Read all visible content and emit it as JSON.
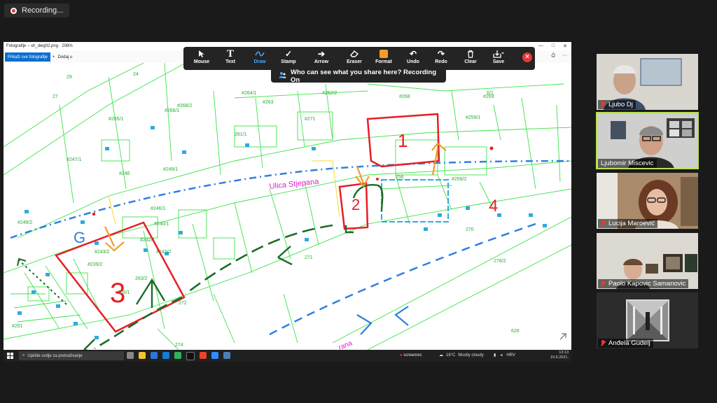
{
  "recording": {
    "label": "Recording..."
  },
  "viewer": {
    "title": "Fotografije – sh_dwg02.png · 208%",
    "tab1": "Prikaži sve fotografije",
    "tab2": "Dodaj u"
  },
  "toolbar": {
    "tools": [
      {
        "label": "Mouse",
        "icon": "mouse-pointer-icon",
        "active": false
      },
      {
        "label": "Text",
        "icon": "text-icon",
        "active": false
      },
      {
        "label": "Draw",
        "icon": "draw-icon",
        "active": true
      },
      {
        "label": "Stamp",
        "icon": "stamp-icon",
        "active": false
      },
      {
        "label": "Arrow",
        "icon": "arrow-icon",
        "active": false
      },
      {
        "label": "Eraser",
        "icon": "eraser-icon",
        "active": false
      },
      {
        "label": "Format",
        "icon": "format-icon",
        "active": false
      },
      {
        "label": "Undo",
        "icon": "undo-icon",
        "active": false
      },
      {
        "label": "Redo",
        "icon": "redo-icon",
        "active": false
      },
      {
        "label": "Clear",
        "icon": "clear-icon",
        "active": false
      },
      {
        "label": "Save",
        "icon": "save-icon",
        "active": false
      }
    ],
    "format_color": "#f39c2b"
  },
  "privacy_banner": {
    "label": "Who can see what you share here? Recording On"
  },
  "map": {
    "street_label": "Ulica Stjepana",
    "street_label2": "rana",
    "areas": [
      "1",
      "2",
      "3",
      "4",
      "G"
    ],
    "parcels": [
      "29",
      "24",
      "27",
      "#262/2",
      "#263",
      "#264/1",
      "#266/1",
      "#268/2",
      "6/1",
      "#269",
      "#265/1",
      "#268",
      "#259/1",
      "#247/1",
      "#246",
      "#249/1",
      "#246/1",
      "#240/1",
      "#249/2",
      "#243/2",
      "#242/1",
      "#242/2",
      "#239/2",
      "265/1",
      "263/2",
      "#271",
      "#251",
      "271",
      "272",
      "274",
      "278/2",
      "270",
      "628",
      "261/1",
      "#259/2",
      "256"
    ],
    "colors": {
      "parcel_lines": "#3de34a",
      "road": "#2f7fe0",
      "red": "#e81e25",
      "orange": "#f39c2b",
      "dark_green": "#1b6b2a",
      "magenta": "#e020d0"
    }
  },
  "taskbar": {
    "search_placeholder": "Upišite ovdje za pretraživanje",
    "screenrec": "screenrec",
    "weather_temp": "18°C",
    "weather_text": "Mostly cloudy",
    "lang": "HRV",
    "time": "13:13",
    "date": "10.6.2021."
  },
  "participants": [
    {
      "name": "Ljubo Dj",
      "muted": true,
      "speaking": false
    },
    {
      "name": "Ljubomir Miscevic",
      "muted": false,
      "speaking": true
    },
    {
      "name": "Lucija Maroević",
      "muted": true,
      "speaking": false
    },
    {
      "name": "Paolo Kapovic Samanovic",
      "muted": true,
      "speaking": false
    },
    {
      "name": "Anđela Gudelj",
      "muted": true,
      "speaking": false
    }
  ]
}
